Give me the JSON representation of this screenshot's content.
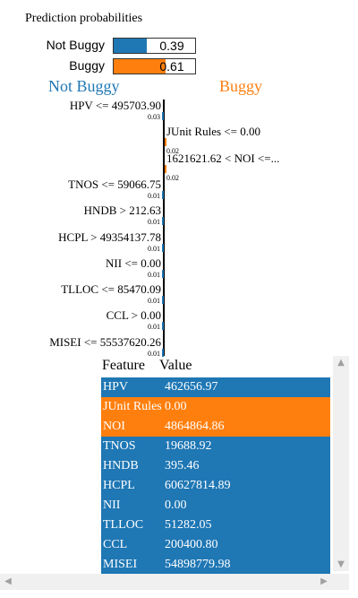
{
  "title": "Prediction probabilities",
  "probabilities": [
    {
      "label": "Not Buggy",
      "value": 0.39,
      "text": "0.39",
      "color": "#1f77b4"
    },
    {
      "label": "Buggy",
      "value": 0.61,
      "text": "0.61",
      "color": "#ff7f0e"
    }
  ],
  "classes": {
    "left": "Not Buggy",
    "right": "Buggy",
    "left_color": "#1f77b4",
    "right_color": "#ff7f0e"
  },
  "chart_data": {
    "type": "bar",
    "orientation": "horizontal",
    "categories": [
      "HPV <= 495703.90",
      "JUnit Rules <= 0.00",
      "1621621.62 < NOI <=...",
      "TNOS <= 59066.75",
      "HNDB > 212.63",
      "HCPL > 49354137.78",
      "NII <= 0.00",
      "TLLOC <= 85470.09",
      "CCL > 0.00",
      "MISEI <= 55537620.26"
    ],
    "values": [
      0.03,
      0.02,
      0.02,
      0.01,
      0.01,
      0.01,
      0.01,
      0.01,
      0.01,
      0.01
    ],
    "value_labels": [
      "0.03",
      "0.02",
      "0.02",
      "0.01",
      "0.01",
      "0.01",
      "0.01",
      "0.01",
      "0.01",
      "0.01"
    ],
    "sides": [
      "Not Buggy",
      "Buggy",
      "Buggy",
      "Not Buggy",
      "Not Buggy",
      "Not Buggy",
      "Not Buggy",
      "Not Buggy",
      "Not Buggy",
      "Not Buggy"
    ]
  },
  "table": {
    "headers": [
      "Feature",
      "Value"
    ],
    "rows": [
      {
        "feature": "HPV",
        "value": "462656.97",
        "color": "#1f77b4"
      },
      {
        "feature": "JUnit Rules",
        "value": "0.00",
        "color": "#ff7f0e"
      },
      {
        "feature": "NOI",
        "value": "4864864.86",
        "color": "#ff7f0e"
      },
      {
        "feature": "TNOS",
        "value": "19688.92",
        "color": "#1f77b4"
      },
      {
        "feature": "HNDB",
        "value": "395.46",
        "color": "#1f77b4"
      },
      {
        "feature": "HCPL",
        "value": "60627814.89",
        "color": "#1f77b4"
      },
      {
        "feature": "NII",
        "value": "0.00",
        "color": "#1f77b4"
      },
      {
        "feature": "TLLOC",
        "value": "51282.05",
        "color": "#1f77b4"
      },
      {
        "feature": "CCL",
        "value": "200400.80",
        "color": "#1f77b4"
      },
      {
        "feature": "MISEI",
        "value": "54898779.98",
        "color": "#1f77b4"
      }
    ]
  },
  "scroll_icons": {
    "up": "▲",
    "down": "▼",
    "left": "◀",
    "right": "▶"
  }
}
